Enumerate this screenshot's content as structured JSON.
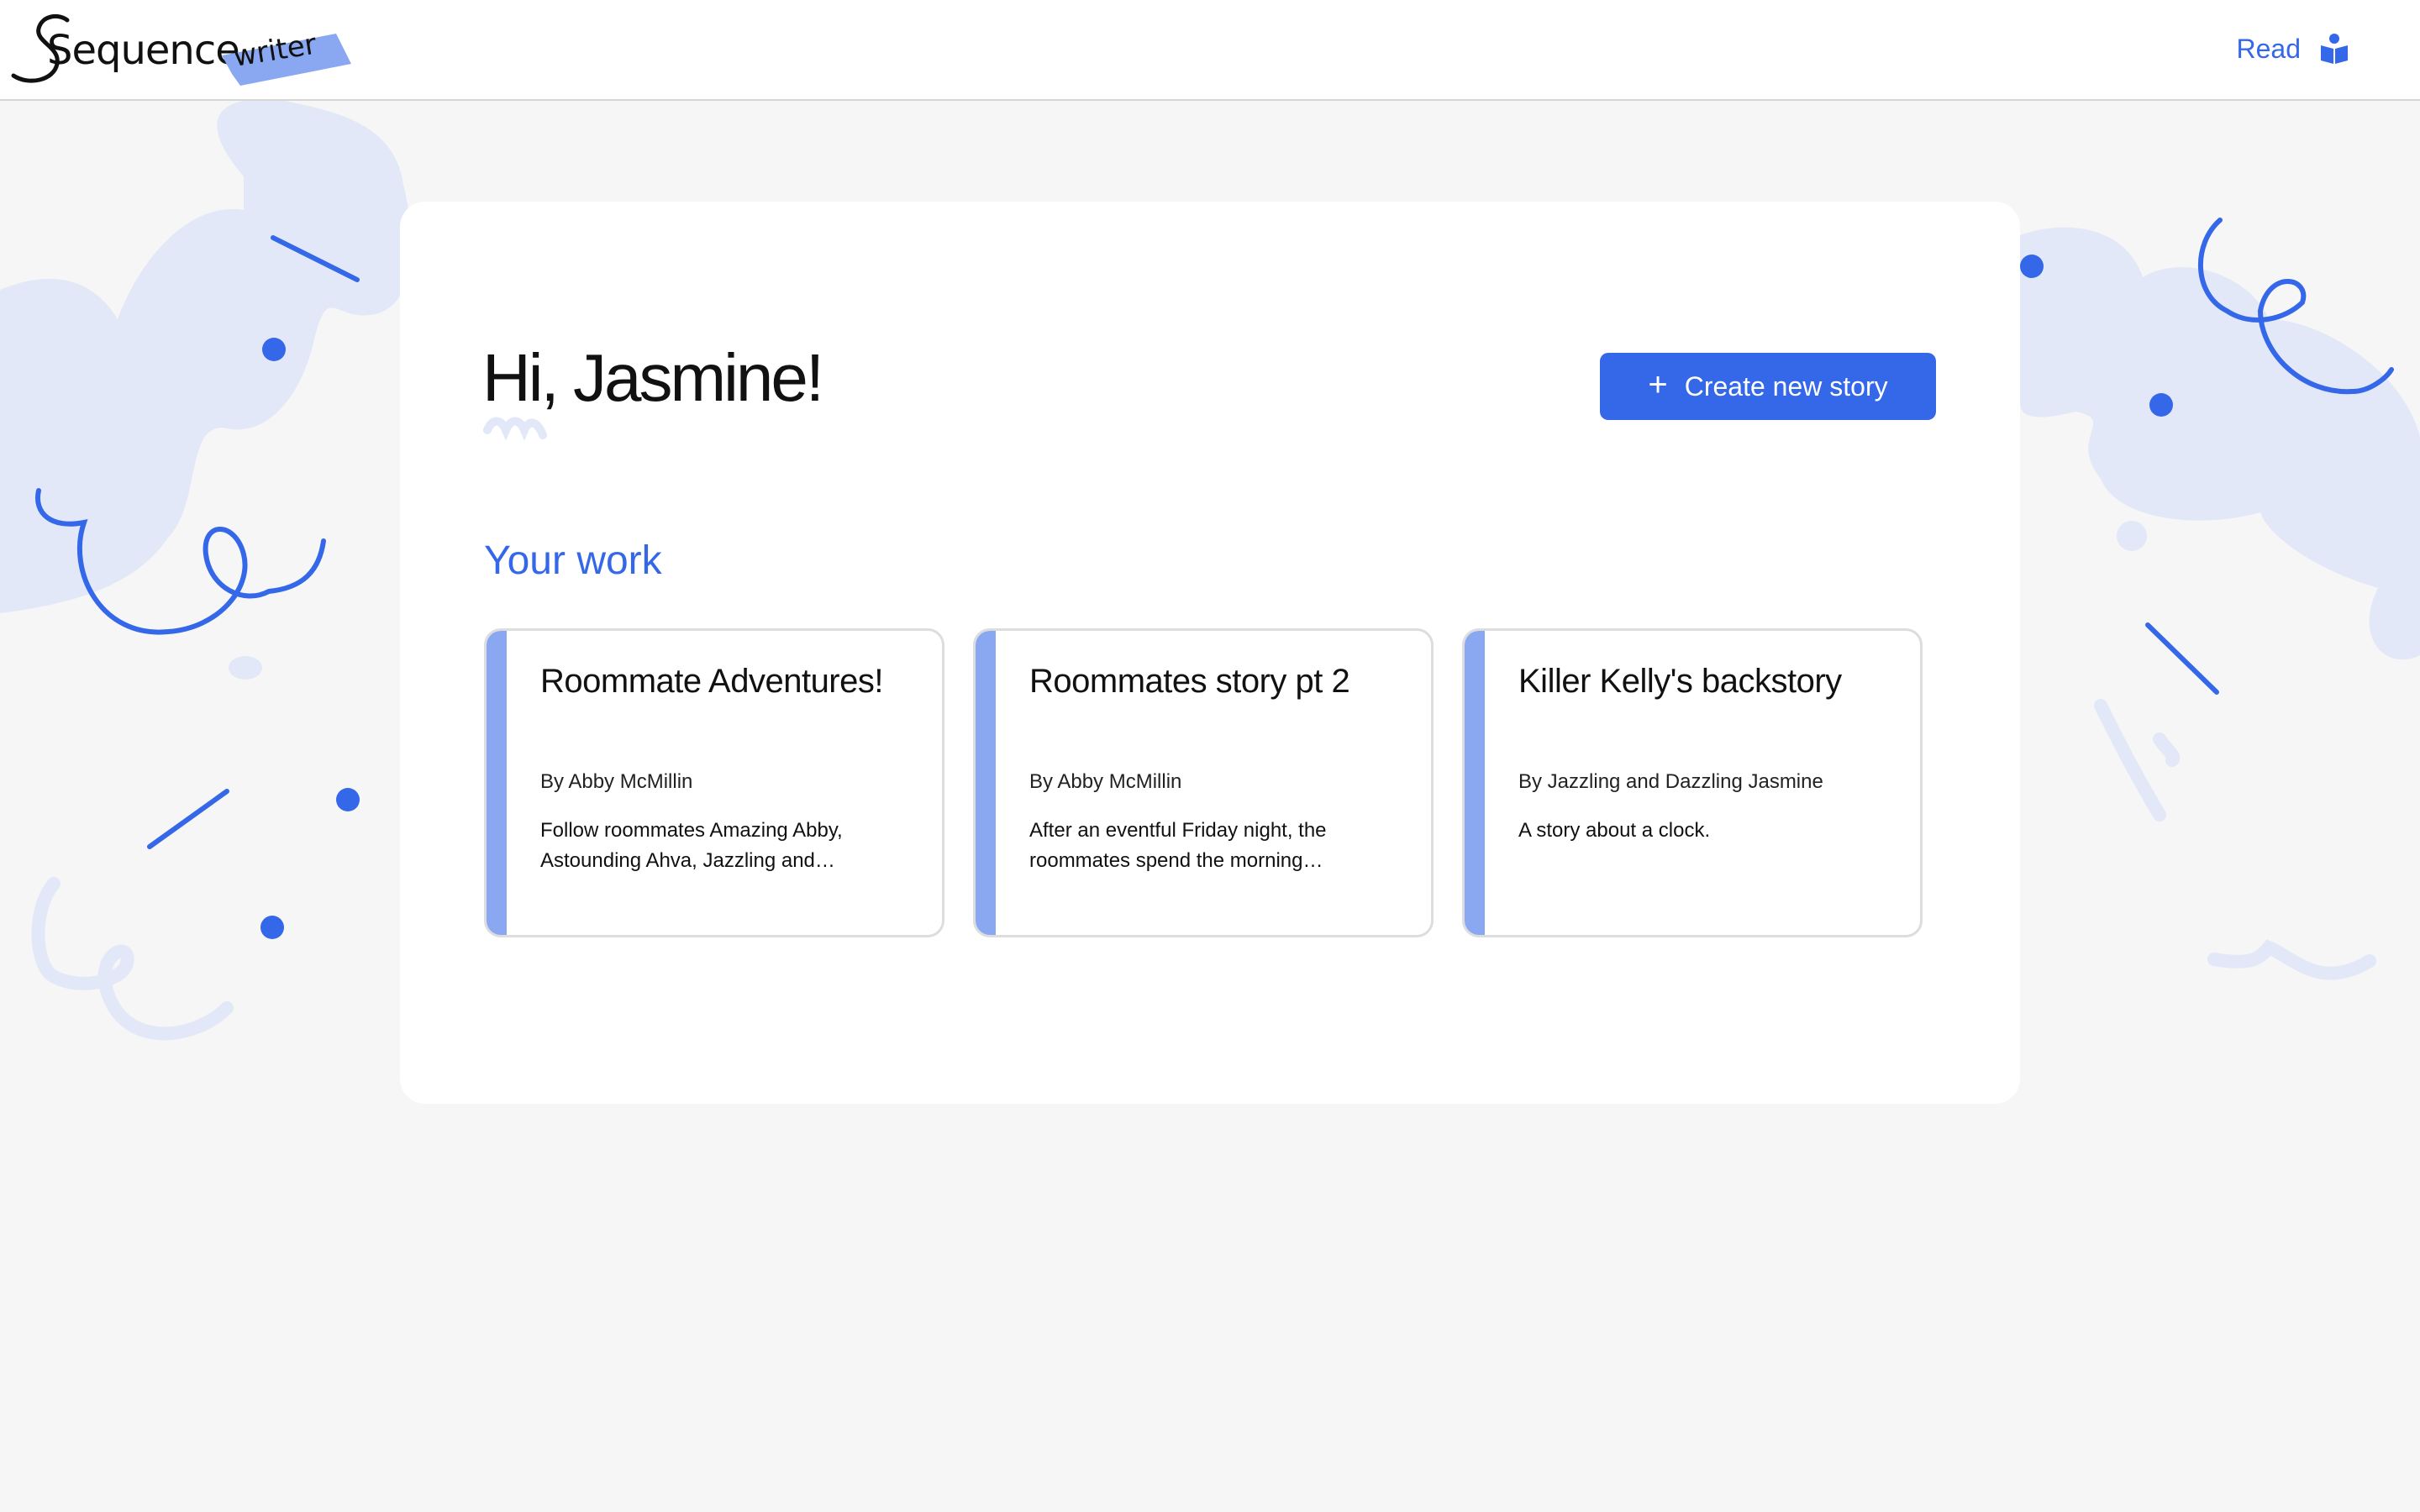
{
  "header": {
    "logo_text": "Sequence",
    "logo_tag": "writer",
    "read_label": "Read",
    "read_icon": "reader-book-icon"
  },
  "main": {
    "greeting": "Hi, Jasmine!",
    "create_button_label": "Create new story",
    "create_button_icon": "plus-icon",
    "section_title": "Your work",
    "stories": [
      {
        "title": "Roommate Adventures!",
        "author": "By Abby McMillin",
        "description": "Follow roommates Amazing Abby, Astounding Ahva, Jazzling and…"
      },
      {
        "title": "Roommates story pt 2",
        "author": "By Abby McMillin",
        "description": "After an eventful Friday night, the roommates spend the morning…"
      },
      {
        "title": "Killer Kelly's backstory",
        "author": "By Jazzling and Dazzling Jasmine",
        "description": "A story about a clock."
      }
    ]
  },
  "colors": {
    "accent": "#3568e8",
    "card_stripe": "#8aa8f2",
    "decoration_light": "#e2e8f7",
    "background": "#f6f6f6"
  }
}
